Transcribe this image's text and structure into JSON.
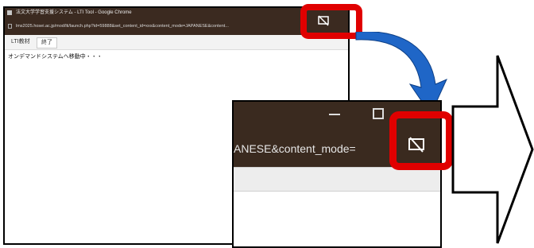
{
  "small_window": {
    "title": "法文大学学習支援システム - LTI Tool - Google Chrome",
    "url": "lms2025.hosei.ac.jp/mod/lti/launch.php?id=59888&set_content_id=xxx&content_mode=JAPANESE&content...",
    "tabs": [
      {
        "label": "LTI教材"
      },
      {
        "label": "終了"
      }
    ],
    "body_text": "オンデマンドシステムへ移動中・・・"
  },
  "zoom_window": {
    "url_fragment": "ANESE&content_mode="
  },
  "icons": {
    "screen_share": "screen-share-off-icon",
    "minimize": "minimize-icon",
    "maximize": "maximize-icon"
  },
  "colors": {
    "highlight": "#e00000",
    "arrow": "#1f66c7",
    "titlebar": "#3b2a20"
  }
}
